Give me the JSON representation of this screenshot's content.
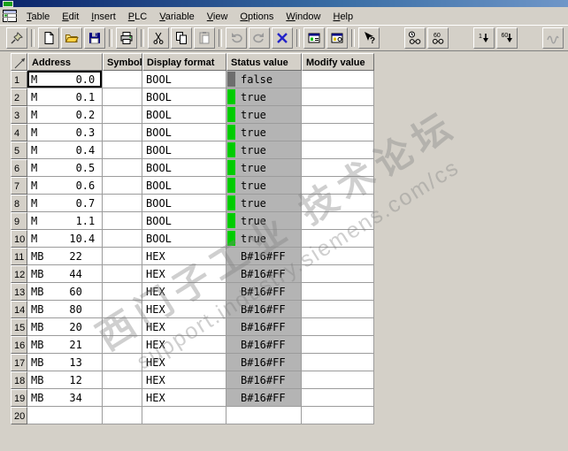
{
  "menu": {
    "items": [
      "Table",
      "Edit",
      "Insert",
      "PLC",
      "Variable",
      "View",
      "Options",
      "Window",
      "Help"
    ]
  },
  "toolbar": {
    "buttons": [
      "pin",
      "new",
      "open",
      "save",
      "print",
      "cut",
      "copy",
      "paste",
      "undo",
      "redo",
      "delete",
      "monitor-window",
      "trigger-window",
      "context-help",
      "monitor-once",
      "monitor",
      "modify-once",
      "modify",
      "enable-peripheral-outputs"
    ],
    "glyph_60": "60",
    "glyph_1": "1",
    "help_glyph": "?"
  },
  "table": {
    "columns": [
      "Address",
      "Symbol",
      "Display format",
      "Status value",
      "Modify value"
    ],
    "rows": [
      {
        "num": "1",
        "address": "M      0.0",
        "symbol": "",
        "format": "BOOL",
        "status": "false",
        "indicator": "gray",
        "modify": "",
        "selected": true
      },
      {
        "num": "2",
        "address": "M      0.1",
        "symbol": "",
        "format": "BOOL",
        "status": "true",
        "indicator": "green",
        "modify": ""
      },
      {
        "num": "3",
        "address": "M      0.2",
        "symbol": "",
        "format": "BOOL",
        "status": "true",
        "indicator": "green",
        "modify": ""
      },
      {
        "num": "4",
        "address": "M      0.3",
        "symbol": "",
        "format": "BOOL",
        "status": "true",
        "indicator": "green",
        "modify": ""
      },
      {
        "num": "5",
        "address": "M      0.4",
        "symbol": "",
        "format": "BOOL",
        "status": "true",
        "indicator": "green",
        "modify": ""
      },
      {
        "num": "6",
        "address": "M      0.5",
        "symbol": "",
        "format": "BOOL",
        "status": "true",
        "indicator": "green",
        "modify": ""
      },
      {
        "num": "7",
        "address": "M      0.6",
        "symbol": "",
        "format": "BOOL",
        "status": "true",
        "indicator": "green",
        "modify": ""
      },
      {
        "num": "8",
        "address": "M      0.7",
        "symbol": "",
        "format": "BOOL",
        "status": "true",
        "indicator": "green",
        "modify": ""
      },
      {
        "num": "9",
        "address": "M      1.1",
        "symbol": "",
        "format": "BOOL",
        "status": "true",
        "indicator": "green",
        "modify": ""
      },
      {
        "num": "10",
        "address": "M     10.4",
        "symbol": "",
        "format": "BOOL",
        "status": "true",
        "indicator": "green",
        "modify": ""
      },
      {
        "num": "11",
        "address": "MB    22",
        "symbol": "",
        "format": "HEX",
        "status": "B#16#FF",
        "indicator": "none",
        "modify": ""
      },
      {
        "num": "12",
        "address": "MB    44",
        "symbol": "",
        "format": "HEX",
        "status": "B#16#FF",
        "indicator": "none",
        "modify": ""
      },
      {
        "num": "13",
        "address": "MB    60",
        "symbol": "",
        "format": "HEX",
        "status": "B#16#FF",
        "indicator": "none",
        "modify": ""
      },
      {
        "num": "14",
        "address": "MB    80",
        "symbol": "",
        "format": "HEX",
        "status": "B#16#FF",
        "indicator": "none",
        "modify": ""
      },
      {
        "num": "15",
        "address": "MB    20",
        "symbol": "",
        "format": "HEX",
        "status": "B#16#FF",
        "indicator": "none",
        "modify": ""
      },
      {
        "num": "16",
        "address": "MB    21",
        "symbol": "",
        "format": "HEX",
        "status": "B#16#FF",
        "indicator": "none",
        "modify": ""
      },
      {
        "num": "17",
        "address": "MB    13",
        "symbol": "",
        "format": "HEX",
        "status": "B#16#FF",
        "indicator": "none",
        "modify": ""
      },
      {
        "num": "18",
        "address": "MB    12",
        "symbol": "",
        "format": "HEX",
        "status": "B#16#FF",
        "indicator": "none",
        "modify": ""
      },
      {
        "num": "19",
        "address": "MB    34",
        "symbol": "",
        "format": "HEX",
        "status": "B#16#FF",
        "indicator": "none",
        "modify": ""
      },
      {
        "num": "20",
        "address": "",
        "symbol": "",
        "format": "",
        "status": "",
        "indicator": "none",
        "modify": ""
      }
    ]
  },
  "watermark": {
    "line1": "西门子工业 技术论坛",
    "line2": "support.industry.siemens.com/cs"
  },
  "colors": {
    "titlebar": "#0a246a",
    "status_bg": "#b4b4b4",
    "indicator_true": "#00cc00",
    "indicator_false": "#6e6e6e"
  }
}
